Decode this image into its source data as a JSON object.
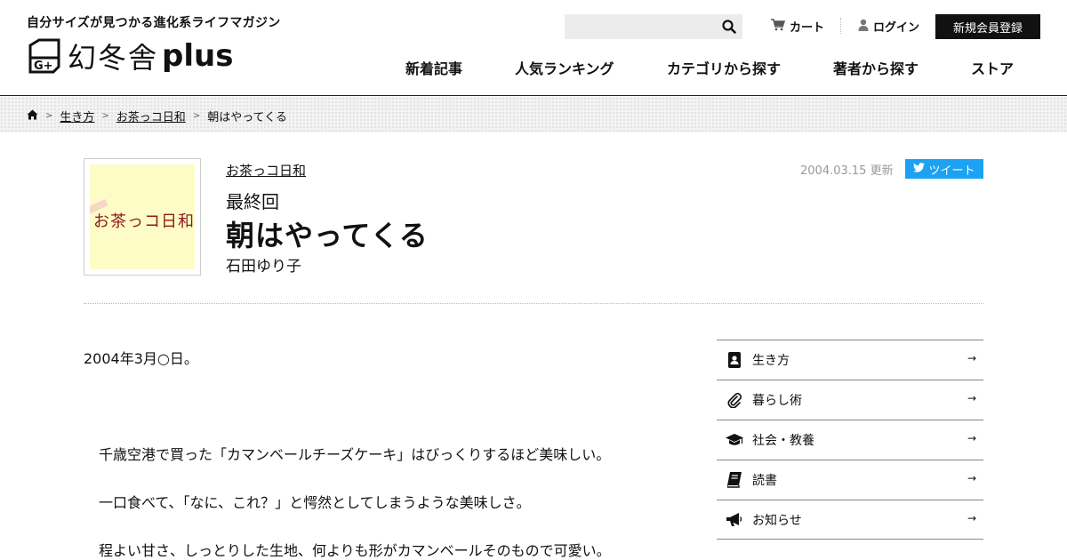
{
  "header": {
    "tagline": "自分サイズが見つかる進化系ライフマガジン",
    "logo_kanji": "幻冬舎",
    "logo_plus": "plus",
    "search": {
      "placeholder": ""
    },
    "cart_label": "カート",
    "login_label": "ログイン",
    "register_label": "新規会員登録",
    "nav": [
      "新着記事",
      "人気ランキング",
      "カテゴリから探す",
      "著者から探す",
      "ストア"
    ]
  },
  "breadcrumb": {
    "items": [
      "生き方",
      "お茶っコ日和"
    ],
    "current": "朝はやってくる"
  },
  "article": {
    "thumbnail_text": "お茶っコ日和",
    "series": "お茶っコ日和",
    "episode": "最終回",
    "title": "朝はやってくる",
    "author": "石田ゆり子",
    "updated": "2004.03.15 更新",
    "tweet_label": "ツイート",
    "date_line": "2004年3月○日。",
    "paragraphs": [
      "千歳空港で買った「カマンベールチーズケーキ」はびっくりするほど美味しい。",
      "一口食べて、「なに、これ？」と愕然としてしまうような美味しさ。",
      "程よい甘さ、しっとりした生地、何よりも形がカマンベールそのもので可愛い。"
    ]
  },
  "sidebar": {
    "items": [
      {
        "label": "生き方",
        "icon": "contact-book-icon"
      },
      {
        "label": "暮らし術",
        "icon": "paperclip-icon"
      },
      {
        "label": "社会・教養",
        "icon": "graduation-cap-icon"
      },
      {
        "label": "読書",
        "icon": "book-icon"
      },
      {
        "label": "お知らせ",
        "icon": "megaphone-icon"
      }
    ]
  }
}
